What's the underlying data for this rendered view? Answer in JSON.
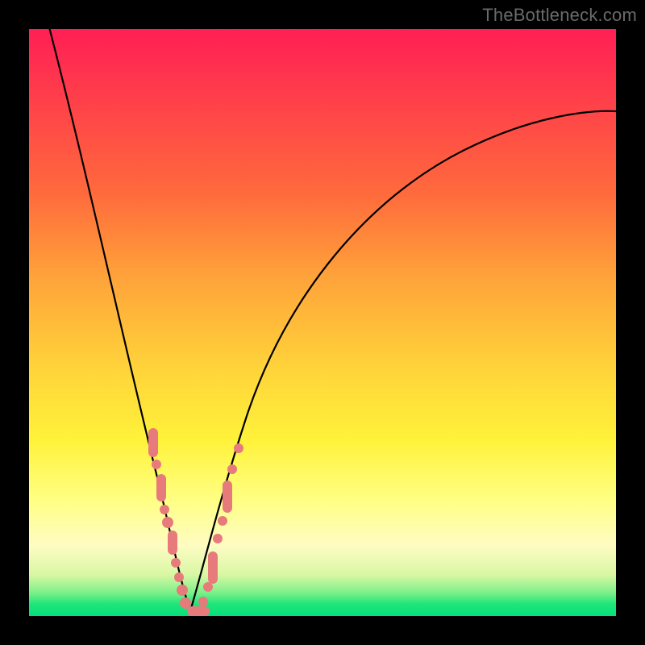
{
  "watermark": "TheBottleneck.com",
  "colors": {
    "dot": "#e77b7b",
    "curve": "#000000"
  },
  "chart_data": {
    "type": "line",
    "title": "",
    "xlabel": "",
    "ylabel": "",
    "xlim": [
      0,
      100
    ],
    "ylim": [
      0,
      100
    ],
    "grid": false,
    "legend": false,
    "annotations": [
      "TheBottleneck.com"
    ],
    "note": "Values estimated from pixel positions; chart has no visible axis tick labels.",
    "series": [
      {
        "name": "left-branch",
        "x": [
          3,
          6,
          10,
          14,
          18,
          20,
          22,
          24,
          25,
          26,
          27
        ],
        "y": [
          100,
          84,
          64,
          44,
          24,
          15,
          8,
          3,
          1,
          0,
          0
        ]
      },
      {
        "name": "right-branch",
        "x": [
          27,
          28,
          30,
          32,
          35,
          40,
          46,
          54,
          62,
          72,
          84,
          96,
          100
        ],
        "y": [
          0,
          1,
          4,
          10,
          20,
          35,
          50,
          62,
          70,
          76,
          81,
          84,
          85
        ]
      }
    ],
    "points": [
      {
        "name": "left-cluster",
        "approx_x_range": [
          19,
          26
        ],
        "approx_y_range": [
          3,
          32
        ]
      },
      {
        "name": "valley-cluster",
        "approx_x_range": [
          25,
          30
        ],
        "approx_y_range": [
          0,
          2
        ]
      },
      {
        "name": "right-cluster",
        "approx_x_range": [
          30,
          35
        ],
        "approx_y_range": [
          4,
          28
        ]
      }
    ]
  }
}
